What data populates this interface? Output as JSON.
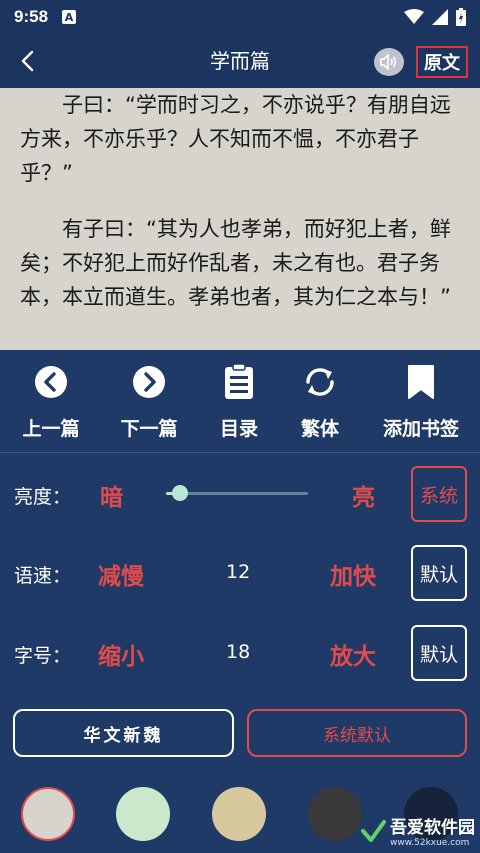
{
  "status": {
    "time": "9:58",
    "notification_letter": "A"
  },
  "header": {
    "title": "学而篇",
    "original_button": "原文"
  },
  "content": {
    "paragraphs": [
      "子曰：“学而时习之，不亦说乎？有朋自远方来，不亦乐乎？人不知而不愠，不亦君子乎？”",
      "有子曰：“其为人也孝弟，而好犯上者，鲜矣；不好犯上而好作乱者，未之有也。君子务本，本立而道生。孝弟也者，其为仁之本与！”"
    ]
  },
  "toolbar": {
    "items": [
      {
        "label": "上一篇",
        "icon": "chevron-left-circle-icon"
      },
      {
        "label": "下一篇",
        "icon": "chevron-right-circle-icon"
      },
      {
        "label": "目录",
        "icon": "document-list-icon"
      },
      {
        "label": "繁体",
        "icon": "sync-icon"
      },
      {
        "label": "添加书签",
        "icon": "bookmark-icon"
      }
    ]
  },
  "settings": {
    "brightness": {
      "label": "亮度：",
      "dark": "暗",
      "bright": "亮",
      "button": "系统",
      "level": 0.1
    },
    "speech_rate": {
      "label": "语速：",
      "decrease": "减慢",
      "value": "12",
      "increase": "加快",
      "button": "默认"
    },
    "font_size": {
      "label": "字号：",
      "decrease": "缩小",
      "value": "18",
      "increase": "放大",
      "button": "默认"
    },
    "font_buttons": {
      "font_name": "华文新魏",
      "system_default": "系统默认"
    }
  },
  "themes": {
    "colors": [
      "#d6d4cd",
      "#cbe8cc",
      "#d8c89d",
      "#3a3a3a",
      "#16233a"
    ],
    "selected_index": 0
  },
  "watermark": {
    "text": "吾爱软件园",
    "sub": "www.52kxue.com"
  }
}
